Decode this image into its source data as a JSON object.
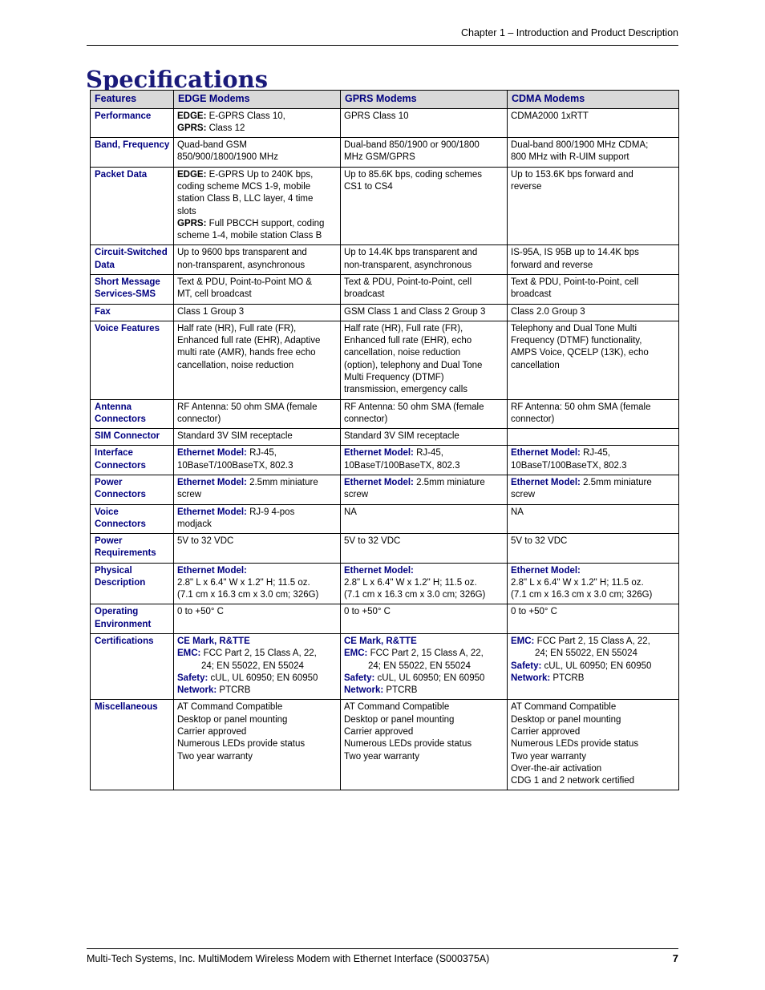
{
  "header": {
    "chapter_text": "Chapter 1 – Introduction and Product Description"
  },
  "title": "Specifications",
  "table": {
    "columns": [
      "Features",
      "EDGE Modems",
      "GPRS Modems",
      "CDMA Modems"
    ],
    "rows": [
      {
        "feature": "Performance",
        "edge": [
          {
            "label": "EDGE:",
            "label_style": "black",
            "text": " E-GPRS Class 10,"
          },
          {
            "label": "GPRS:",
            "label_style": "black",
            "text": " Class 12"
          }
        ],
        "gprs": [
          {
            "text": "GPRS Class 10"
          }
        ],
        "cdma": [
          {
            "text": "CDMA2000 1xRTT"
          }
        ]
      },
      {
        "feature": "Band, Frequency",
        "edge": [
          {
            "text": "Quad-band GSM"
          },
          {
            "text": "850/900/1800/1900 MHz"
          }
        ],
        "gprs": [
          {
            "text": "Dual-band 850/1900 or 900/1800"
          },
          {
            "text": "MHz GSM/GPRS"
          }
        ],
        "cdma": [
          {
            "text": "Dual-band 800/1900 MHz CDMA;"
          },
          {
            "text": "800 MHz with R-UIM support"
          }
        ]
      },
      {
        "feature": "Packet Data",
        "edge": [
          {
            "label": "EDGE:",
            "label_style": "black",
            "text": " E-GPRS Up to 240K bps,"
          },
          {
            "text": "coding scheme MCS 1-9, mobile"
          },
          {
            "text": "station Class B, LLC layer, 4 time"
          },
          {
            "text": "slots"
          },
          {
            "label": "GPRS:",
            "label_style": "black",
            "text": " Full PBCCH support, coding"
          },
          {
            "text": "scheme 1-4, mobile station Class B"
          }
        ],
        "gprs": [
          {
            "text": "Up to 85.6K bps, coding schemes"
          },
          {
            "text": "CS1 to CS4"
          }
        ],
        "cdma": [
          {
            "text": "Up to 153.6K bps forward and"
          },
          {
            "text": "reverse"
          }
        ]
      },
      {
        "feature": "Circuit-Switched Data",
        "edge": [
          {
            "text": "Up to 9600 bps transparent and"
          },
          {
            "text": "non-transparent, asynchronous"
          }
        ],
        "gprs": [
          {
            "text": "Up to 14.4K bps transparent and"
          },
          {
            "text": "non-transparent, asynchronous"
          }
        ],
        "cdma": [
          {
            "text": "IS-95A, IS 95B up to 14.4K bps"
          },
          {
            "text": "forward and reverse"
          }
        ]
      },
      {
        "feature": "Short Message Services-SMS",
        "edge": [
          {
            "text": "Text & PDU, Point-to-Point MO &"
          },
          {
            "text": "MT, cell broadcast"
          }
        ],
        "gprs": [
          {
            "text": "Text & PDU, Point-to-Point, cell"
          },
          {
            "text": "broadcast"
          }
        ],
        "cdma": [
          {
            "text": "Text & PDU, Point-to-Point, cell"
          },
          {
            "text": "broadcast"
          }
        ]
      },
      {
        "feature": "Fax",
        "edge": [
          {
            "text": "Class 1 Group 3"
          }
        ],
        "gprs": [
          {
            "text": "GSM Class 1 and Class 2 Group 3"
          }
        ],
        "cdma": [
          {
            "text": "Class 2.0 Group 3"
          }
        ]
      },
      {
        "feature": "Voice Features",
        "edge": [
          {
            "text": "Half rate (HR), Full rate (FR),"
          },
          {
            "text": "Enhanced full rate (EHR), Adaptive"
          },
          {
            "text": "multi rate (AMR), hands free echo"
          },
          {
            "text": "cancellation, noise reduction"
          }
        ],
        "gprs": [
          {
            "text": "Half rate (HR), Full rate (FR),"
          },
          {
            "text": "Enhanced full rate (EHR), echo"
          },
          {
            "text": "cancellation, noise reduction"
          },
          {
            "text": "(option), telephony and Dual Tone"
          },
          {
            "text": "Multi Frequency (DTMF)"
          },
          {
            "text": "transmission, emergency calls"
          }
        ],
        "cdma": [
          {
            "text": "Telephony and Dual Tone Multi"
          },
          {
            "text": "Frequency (DTMF) functionality,"
          },
          {
            "text": "AMPS Voice, QCELP (13K), echo"
          },
          {
            "text": "cancellation"
          }
        ]
      },
      {
        "feature": "Antenna Connectors",
        "edge": [
          {
            "text": "RF Antenna: 50 ohm SMA (female"
          },
          {
            "text": "connector)"
          }
        ],
        "gprs": [
          {
            "text": "RF Antenna: 50 ohm SMA (female"
          },
          {
            "text": "connector)"
          }
        ],
        "cdma": [
          {
            "text": "RF Antenna: 50 ohm SMA (female"
          },
          {
            "text": "connector)"
          }
        ]
      },
      {
        "feature": "SIM Connector",
        "edge": [
          {
            "text": "Standard 3V SIM receptacle"
          }
        ],
        "gprs": [
          {
            "text": "Standard 3V SIM receptacle"
          }
        ],
        "cdma": []
      },
      {
        "feature": "Interface Connectors",
        "edge": [
          {
            "label": "Ethernet Model:",
            "label_style": "blue",
            "text": " RJ-45,"
          },
          {
            "text": "10BaseT/100BaseTX, 802.3"
          }
        ],
        "gprs": [
          {
            "label": "Ethernet Model:",
            "label_style": "blue",
            "text": " RJ-45,"
          },
          {
            "text": "10BaseT/100BaseTX, 802.3"
          }
        ],
        "cdma": [
          {
            "label": "Ethernet Model:",
            "label_style": "blue",
            "text": " RJ-45,"
          },
          {
            "text": "10BaseT/100BaseTX, 802.3"
          }
        ]
      },
      {
        "feature": "Power Connectors",
        "edge": [
          {
            "label": "Ethernet Model:",
            "label_style": "blue",
            "text": " 2.5mm miniature"
          },
          {
            "text": "screw"
          }
        ],
        "gprs": [
          {
            "label": "Ethernet Model:",
            "label_style": "blue",
            "text": " 2.5mm miniature"
          },
          {
            "text": "screw"
          }
        ],
        "cdma": [
          {
            "label": "Ethernet Model:",
            "label_style": "blue",
            "text": " 2.5mm miniature"
          },
          {
            "text": "screw"
          }
        ]
      },
      {
        "feature": "Voice Connectors",
        "edge": [
          {
            "label": "Ethernet Model:",
            "label_style": "blue",
            "text": " RJ-9 4-pos"
          },
          {
            "text": "modjack"
          }
        ],
        "gprs": [
          {
            "text": "NA"
          }
        ],
        "cdma": [
          {
            "text": "NA"
          }
        ]
      },
      {
        "feature": "Power Requirements",
        "edge": [
          {
            "text": "5V to 32 VDC"
          }
        ],
        "gprs": [
          {
            "text": "5V to 32 VDC"
          }
        ],
        "cdma": [
          {
            "text": "5V to 32 VDC"
          }
        ]
      },
      {
        "feature": "Physical Description",
        "edge": [
          {
            "label": "Ethernet Model:",
            "label_style": "blue",
            "text": ""
          },
          {
            "text": "2.8\" L x 6.4\" W x 1.2\" H; 11.5 oz."
          },
          {
            "text": "(7.1 cm x 16.3 cm x 3.0 cm; 326G)"
          }
        ],
        "gprs": [
          {
            "label": "Ethernet Model:",
            "label_style": "blue",
            "text": ""
          },
          {
            "text": "2.8\" L x 6.4\" W x 1.2\" H; 11.5 oz."
          },
          {
            "text": "(7.1 cm x 16.3 cm x 3.0 cm; 326G)"
          }
        ],
        "cdma": [
          {
            "label": "Ethernet Model:",
            "label_style": "blue",
            "text": ""
          },
          {
            "text": "2.8\" L x 6.4\" W x 1.2\" H; 11.5 oz."
          },
          {
            "text": "(7.1 cm x 16.3 cm x 3.0 cm; 326G)"
          }
        ]
      },
      {
        "feature": "Operating Environment",
        "edge": [
          {
            "text": "0 to +50° C"
          }
        ],
        "gprs": [
          {
            "text": "0 to +50° C"
          }
        ],
        "cdma": [
          {
            "text": "0 to +50° C"
          }
        ]
      },
      {
        "feature": "Certifications",
        "edge": [
          {
            "label": "CE Mark, R&TTE",
            "label_style": "blue",
            "text": ""
          },
          {
            "label": "EMC:",
            "label_style": "blue",
            "text": " FCC Part 2, 15 Class A, 22,"
          },
          {
            "text": "24; EN 55022, EN 55024",
            "indent": true
          },
          {
            "label": "Safety:",
            "label_style": "blue",
            "text": " cUL, UL 60950; EN 60950"
          },
          {
            "label": "Network:",
            "label_style": "blue",
            "text": " PTCRB"
          }
        ],
        "gprs": [
          {
            "label": "CE Mark, R&TTE",
            "label_style": "blue",
            "text": ""
          },
          {
            "label": "EMC:",
            "label_style": "blue",
            "text": " FCC Part 2, 15 Class A, 22,"
          },
          {
            "text": "24; EN 55022, EN 55024",
            "indent": true
          },
          {
            "label": "Safety:",
            "label_style": "blue",
            "text": " cUL, UL 60950; EN 60950"
          },
          {
            "label": "Network:",
            "label_style": "blue",
            "text": " PTCRB"
          }
        ],
        "cdma": [
          {
            "label": "EMC:",
            "label_style": "blue",
            "text": "  FCC Part 2, 15 Class A, 22,"
          },
          {
            "text": "24; EN 55022, EN 55024",
            "indent": true
          },
          {
            "label": "Safety:",
            "label_style": "blue",
            "text": " cUL, UL 60950; EN 60950"
          },
          {
            "label": "Network:",
            "label_style": "blue",
            "text": " PTCRB"
          }
        ]
      },
      {
        "feature": "Miscellaneous",
        "edge": [
          {
            "text": "AT Command Compatible"
          },
          {
            "text": "Desktop or panel mounting"
          },
          {
            "text": "Carrier approved"
          },
          {
            "text": "Numerous LEDs provide status"
          },
          {
            "text": "Two year warranty"
          }
        ],
        "gprs": [
          {
            "text": "AT Command Compatible"
          },
          {
            "text": "Desktop or panel mounting"
          },
          {
            "text": "Carrier approved"
          },
          {
            "text": "Numerous LEDs provide status"
          },
          {
            "text": "Two year warranty"
          }
        ],
        "cdma": [
          {
            "text": "AT Command Compatible"
          },
          {
            "text": "Desktop or panel mounting"
          },
          {
            "text": "Carrier approved"
          },
          {
            "text": "Numerous LEDs provide status"
          },
          {
            "text": "Two year warranty"
          },
          {
            "text": "Over-the-air activation"
          },
          {
            "text": "CDG 1 and 2 network certified"
          }
        ]
      }
    ]
  },
  "footer": {
    "text": "Multi-Tech Systems, Inc. MultiModem Wireless Modem with Ethernet Interface (S000375A)",
    "page_number": "7"
  },
  "colors": {
    "heading_navy": "#000080",
    "title_navy": "#1a1a7a",
    "header_row_bg": "#d9d9d9",
    "border": "#000000"
  }
}
